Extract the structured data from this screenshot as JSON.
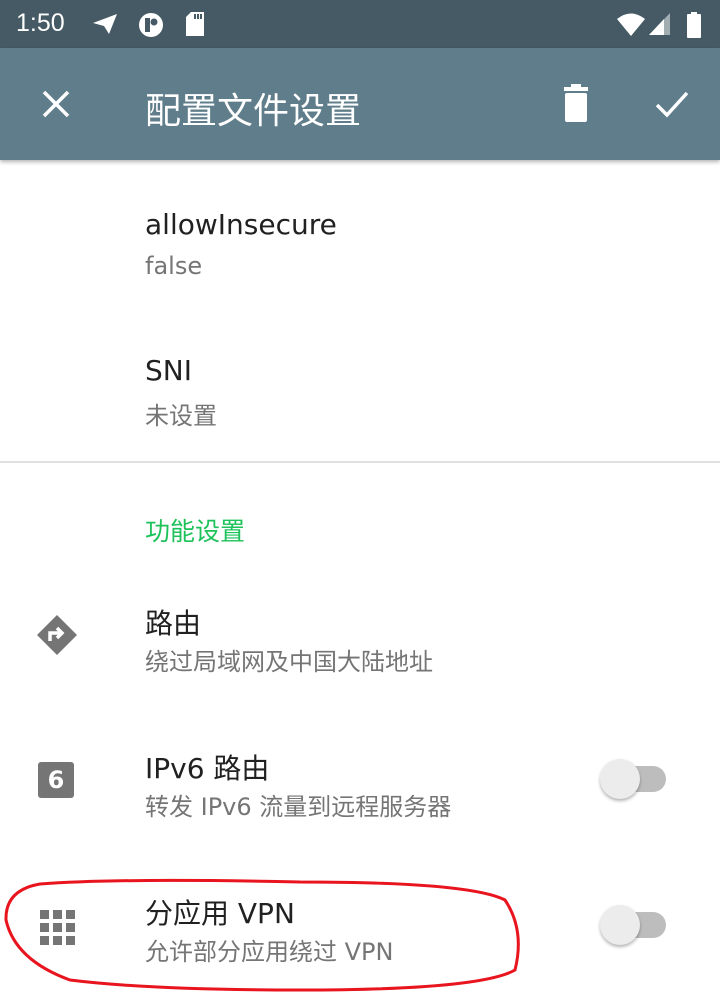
{
  "status_bar": {
    "time": "1:50",
    "icons": [
      "telegram-icon",
      "app-notification-icon",
      "sd-card-icon",
      "wifi-icon",
      "signal-icon",
      "battery-icon"
    ]
  },
  "toolbar": {
    "title": "配置文件设置",
    "close_icon": "close-icon",
    "delete_icon": "delete-icon",
    "save_icon": "check-icon"
  },
  "items": [
    {
      "title": "allowInsecure",
      "summary": "false"
    },
    {
      "title": "SNI",
      "summary": "未设置"
    }
  ],
  "section": {
    "title": "功能设置"
  },
  "features": [
    {
      "title": "路由",
      "summary": "绕过局域网及中国大陆地址",
      "icon": "route-icon"
    },
    {
      "title": "IPv6 路由",
      "summary": "转发 IPv6 流量到远程服务器",
      "icon": "ipv6-icon",
      "icon_text": "6",
      "switch_on": false
    },
    {
      "title": "分应用 VPN",
      "summary": "允许部分应用绕过 VPN",
      "icon": "apps-grid-icon",
      "switch_on": false
    }
  ],
  "colors": {
    "status_bar": "#455a64",
    "toolbar": "#607d8b",
    "section_accent": "#1ec25a",
    "annotation": "#e8141e"
  }
}
